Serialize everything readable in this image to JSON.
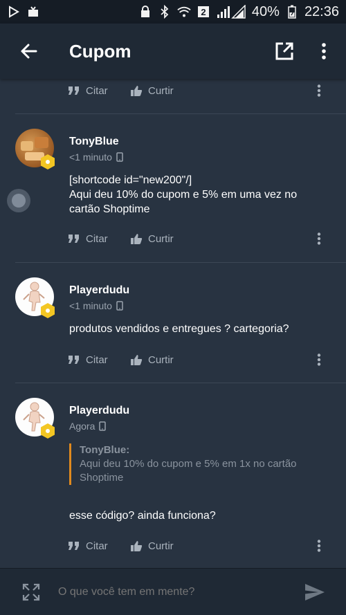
{
  "status_bar": {
    "left_icons": [
      "play-store-icon",
      "download-icon"
    ],
    "right_icons": [
      "lock-icon",
      "bluetooth-icon",
      "wifi-icon",
      "sim-icon",
      "signal-icon",
      "battery-icon"
    ],
    "sim_number": "2",
    "battery_percent": "40%",
    "time": "22:36"
  },
  "app_bar": {
    "title": "Cupom"
  },
  "actions": {
    "cite_label": "Citar",
    "like_label": "Curtir"
  },
  "posts": [
    {
      "author": "TonyBlue",
      "time": "<1 minuto",
      "lines": [
        "[shortcode id=\"new200\"/]",
        "Aqui deu 10% do cupom e 5% em uma vez no",
        "cartão Shoptime"
      ]
    },
    {
      "author": "Playerdudu",
      "time": "<1 minuto",
      "lines": [
        "produtos  vendidos e entregues  ?  cartegoria?"
      ]
    },
    {
      "author": "Playerdudu",
      "time": "Agora",
      "quote_author": "TonyBlue:",
      "quote_lines": [
        "Aqui deu 10% do cupom e 5% em 1x no cartão",
        "Shoptime"
      ],
      "lines": [
        "esse código?  ainda funciona?"
      ]
    }
  ],
  "composer": {
    "placeholder": "O que você tem em mente?"
  },
  "colors": {
    "background": "#283341",
    "app_bar": "#1f2935",
    "status_bar": "#151c25",
    "badge": "#f3c623",
    "quote_accent": "#e08a1e"
  }
}
